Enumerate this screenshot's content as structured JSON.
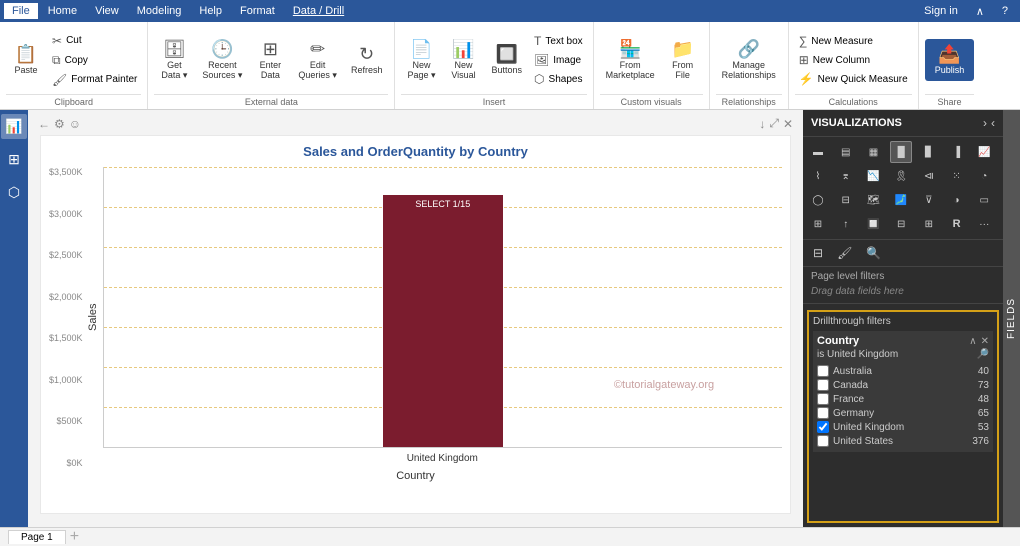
{
  "menuBar": {
    "items": [
      "File",
      "Home",
      "View",
      "Modeling",
      "Help",
      "Format",
      "Data / Drill"
    ],
    "activeIndex": 0,
    "homeActiveIndex": 1,
    "formatActiveIndex": 5,
    "dataDrillActiveIndex": 6
  },
  "ribbon": {
    "clipboard": {
      "label": "Clipboard",
      "paste": "Paste",
      "cut": "Cut",
      "copy": "Copy",
      "formatPainter": "Format Painter"
    },
    "externalData": {
      "label": "External data",
      "getData": "Get Data",
      "recentSources": "Recent Sources",
      "enterData": "Enter Data",
      "editQueries": "Edit Queries",
      "refresh": "Refresh"
    },
    "insert": {
      "label": "Insert",
      "newPage": "New Page",
      "newVisual": "New Visual",
      "buttons": "Buttons",
      "textbox": "Text box",
      "image": "Image",
      "shapes": "Shapes"
    },
    "customVisuals": {
      "label": "Custom visuals",
      "fromMarketplace": "From Marketplace",
      "fromFile": "From File"
    },
    "relationships": {
      "label": "Relationships",
      "manageRelationships": "Manage Relationships"
    },
    "calculations": {
      "label": "Calculations",
      "newMeasure": "New Measure",
      "newColumn": "New Column",
      "newQuickMeasure": "New Quick Measure"
    },
    "share": {
      "label": "Share",
      "publish": "Publish"
    }
  },
  "canvas": {
    "title": "Sales and OrderQuantity by Country",
    "yAxisLabel": "Sales",
    "xAxisLabel": "Country",
    "barLabel": "SELECT 1/15",
    "watermark": "©tutorialgateway.org",
    "xCategory": "United Kingdom",
    "yTicks": [
      "$3,500K",
      "$3,000K",
      "$2,500K",
      "$2,000K",
      "$1,500K",
      "$1,000K",
      "$500K",
      "$0K"
    ]
  },
  "visualizations": {
    "title": "VISUALIZATIONS",
    "pageFilters": {
      "title": "Page level filters",
      "dragHint": "Drag data fields here"
    },
    "drillthrough": {
      "title": "Drillthrough filters",
      "field": {
        "name": "Country",
        "condition": "is United Kingdom",
        "items": [
          {
            "label": "Australia",
            "count": 40,
            "checked": false
          },
          {
            "label": "Canada",
            "count": 73,
            "checked": false
          },
          {
            "label": "France",
            "count": 48,
            "checked": false
          },
          {
            "label": "Germany",
            "count": 65,
            "checked": false
          },
          {
            "label": "United Kingdom",
            "count": 53,
            "checked": true
          },
          {
            "label": "United States",
            "count": 376,
            "checked": false
          }
        ]
      }
    }
  },
  "fields": {
    "label": "FIELDS"
  },
  "statusBar": {
    "page": "Page 1"
  }
}
